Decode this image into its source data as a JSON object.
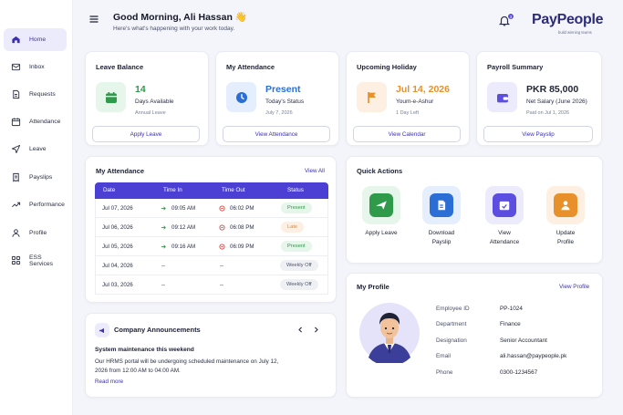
{
  "sidebar": {
    "items": [
      {
        "label": "Home",
        "icon": "home-icon"
      },
      {
        "label": "Inbox",
        "icon": "mail-icon"
      },
      {
        "label": "Requests",
        "icon": "document-icon"
      },
      {
        "label": "Attendance",
        "icon": "calendar-icon"
      },
      {
        "label": "Leave",
        "icon": "send-icon"
      },
      {
        "label": "Payslips",
        "icon": "receipt-icon"
      },
      {
        "label": "Performance",
        "icon": "chart-icon"
      },
      {
        "label": "Profile",
        "icon": "user-icon"
      },
      {
        "label": "ESS Services",
        "icon": "grid-icon"
      }
    ],
    "active": "Home"
  },
  "header": {
    "greeting": "Good Morning, Ali Hassan 👋",
    "subtitle": "Here's what's happening with your work today.",
    "notification_count": "3",
    "logo": "PayPeople",
    "logo_tagline": "build winning teams"
  },
  "summary": {
    "leave": {
      "title": "Leave Balance",
      "value": "14",
      "desc": "Days Available",
      "sub": "Annual Leave",
      "button": "Apply Leave",
      "color": "#2f9a4a"
    },
    "attendance": {
      "title": "My Attendance",
      "value": "Present",
      "desc": "Today's Status",
      "sub": "July 7, 2026",
      "button": "View Attendance",
      "color": "#2b6fd6"
    },
    "holiday": {
      "title": "Upcoming Holiday",
      "value": "Jul 14, 2026",
      "desc": "Youm-e-Ashur",
      "sub": "1 Day Left",
      "button": "View Calendar",
      "color": "#e8902a"
    },
    "payroll": {
      "title": "Payroll Summary",
      "value": "PKR 85,000",
      "desc": "Net Salary (June 2026)",
      "sub": "Paid on Jul 1, 2026",
      "button": "View Payslip",
      "color": "#1f2333"
    }
  },
  "attendance_table": {
    "title": "My Attendance",
    "view_all": "View All",
    "columns": [
      "Date",
      "Time In",
      "Time Out",
      "Status"
    ],
    "rows": [
      {
        "date": "Jul 07, 2026",
        "in": "09:05 AM",
        "out": "06:02 PM",
        "status": "Present"
      },
      {
        "date": "Jul 06, 2026",
        "in": "09:12 AM",
        "out": "06:08 PM",
        "status": "Late"
      },
      {
        "date": "Jul 05, 2026",
        "in": "09:16 AM",
        "out": "06:09 PM",
        "status": "Present"
      },
      {
        "date": "Jul 04, 2026",
        "in": "--",
        "out": "--",
        "status": "Weekly Off"
      },
      {
        "date": "Jul 03, 2026",
        "in": "--",
        "out": "--",
        "status": "Weekly Off"
      }
    ]
  },
  "quick_actions": {
    "title": "Quick Actions",
    "items": [
      {
        "label": "Apply Leave",
        "icon": "airplane-icon",
        "color": "#2f9a4a"
      },
      {
        "label": "Download Payslip",
        "icon": "file-icon",
        "color": "#2b6fd6"
      },
      {
        "label": "View Attendance",
        "icon": "calendar-check-icon",
        "color": "#5b4ee0"
      },
      {
        "label": "Update Profile",
        "icon": "user-icon",
        "color": "#e8902a"
      }
    ]
  },
  "announcements": {
    "title": "Company Announcements",
    "headline": "System maintenance this weekend",
    "body": "Our HRMS portal will be undergoing scheduled maintenance on July 12, 2026 from 12:00 AM to 04:00 AM.",
    "link": "Read more"
  },
  "profile": {
    "title": "My Profile",
    "view_link": "View Profile",
    "fields": [
      {
        "label": "Employee ID",
        "value": "PP-1024"
      },
      {
        "label": "Department",
        "value": "Finance"
      },
      {
        "label": "Designation",
        "value": "Senior Accountant"
      },
      {
        "label": "Email",
        "value": "ali.hassan@paypeople.pk"
      },
      {
        "label": "Phone",
        "value": "0300-1234567"
      }
    ]
  }
}
